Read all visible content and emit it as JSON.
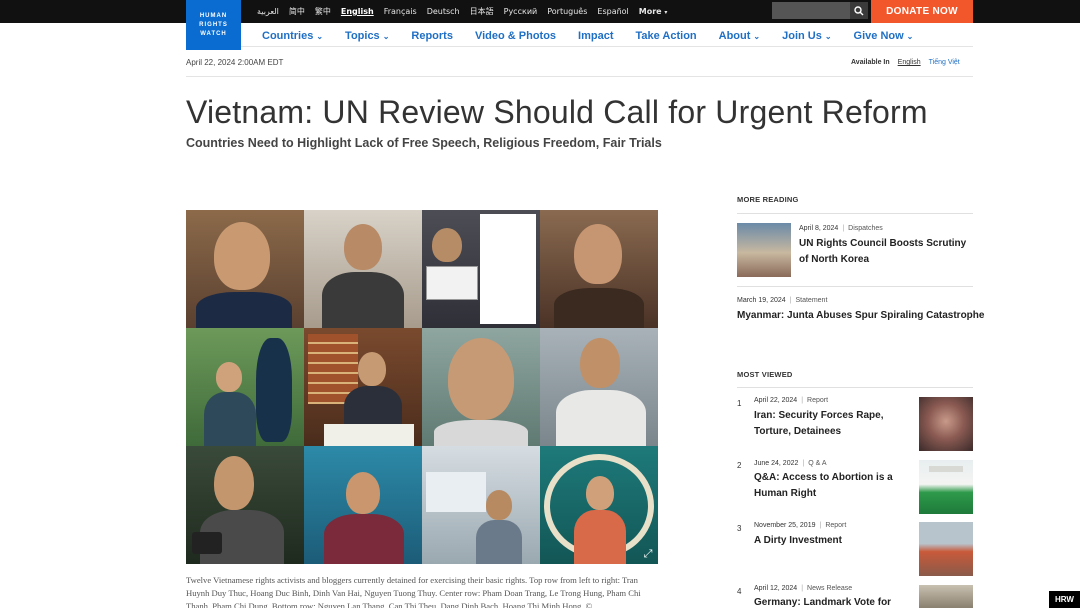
{
  "logo": {
    "lines": [
      "HUMAN",
      "RIGHTS",
      "WATCH"
    ]
  },
  "languages": [
    "العربية",
    "简中",
    "繁中",
    "English",
    "Français",
    "Deutsch",
    "日本語",
    "Русский",
    "Português",
    "Español"
  ],
  "languages_more": "More",
  "search": {
    "placeholder": ""
  },
  "donate_label": "DONATE NOW",
  "nav": [
    "Countries",
    "Topics",
    "Reports",
    "Video & Photos",
    "Impact",
    "Take Action",
    "About",
    "Join Us",
    "Give Now"
  ],
  "article": {
    "date": "April 22, 2024 2:00AM EDT",
    "available_label": "Available In",
    "available_langs": [
      "English",
      "Tiếng Việt"
    ],
    "title": "Vietnam: UN Review Should Call for Urgent Reform",
    "subtitle": "Countries Need to Highlight Lack of Free Speech, Religious Freedom, Fair Trials",
    "caption": "Twelve Vietnamese rights activists and bloggers currently detained for exercising their basic rights. Top row from left to right: Tran Huynh Duy Thuc, Hoang Duc Binh, Dinh Van Hai, Nguyen Tuong Thuy. Center row:  Pham Doan Trang, Le Trong Hung, Pham Chi Thanh, Pham Chi Dung. Bottom row: Nguyen Lan Thang, Can Thi Theu, Dang Dinh Bach, Hoang Thi Minh Hong. ©"
  },
  "more_reading": {
    "heading": "MORE READING",
    "items": [
      {
        "date": "April 8, 2024",
        "type": "Dispatches",
        "title": "UN Rights Council Boosts Scrutiny of North Korea"
      },
      {
        "date": "March 19, 2024",
        "type": "Statement",
        "title": "Myanmar: Junta Abuses Spur Spiraling Catastrophe"
      }
    ]
  },
  "most_viewed": {
    "heading": "MOST VIEWED",
    "items": [
      {
        "num": "1",
        "date": "April 22, 2024",
        "type": "Report",
        "title": "Iran: Security Forces Rape, Torture, Detainees"
      },
      {
        "num": "2",
        "date": "June 24, 2022",
        "type": "Q & A",
        "title": "Q&A: Access to Abortion is a Human Right"
      },
      {
        "num": "3",
        "date": "November 25, 2019",
        "type": "Report",
        "title": "A Dirty Investment"
      },
      {
        "num": "4",
        "date": "April 12, 2024",
        "type": "News Release",
        "title": "Germany: Landmark Vote for"
      }
    ]
  },
  "watermark": "HRW"
}
